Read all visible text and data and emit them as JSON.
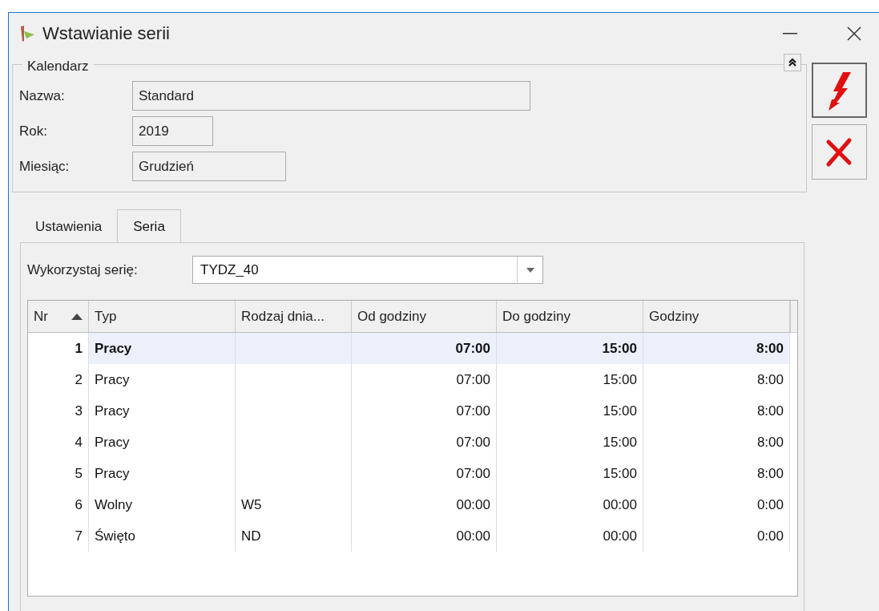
{
  "window": {
    "title": "Wstawianie serii"
  },
  "calendar": {
    "legend": "Kalendarz",
    "fields": [
      {
        "label": "Nazwa:",
        "value": "Standard"
      },
      {
        "label": "Rok:",
        "value": "2019"
      },
      {
        "label": "Miesiąc:",
        "value": "Grudzień"
      }
    ]
  },
  "tabs": [
    {
      "label": "Ustawienia",
      "selected": false
    },
    {
      "label": "Seria",
      "selected": true
    }
  ],
  "series": {
    "label": "Wykorzystaj serię:",
    "value": "TYDZ_40"
  },
  "table": {
    "columns": [
      {
        "label": "Nr",
        "sorted": true
      },
      {
        "label": "Typ",
        "sorted": false
      },
      {
        "label": "Rodzaj dnia...",
        "sorted": false
      },
      {
        "label": "Od godziny",
        "sorted": false
      },
      {
        "label": "Do godziny",
        "sorted": false
      },
      {
        "label": "Godziny",
        "sorted": false
      }
    ],
    "rows": [
      {
        "nr": "1",
        "typ": "Pracy",
        "rodzaj": "",
        "od": "07:00",
        "do": "15:00",
        "godziny": "8:00",
        "selected": true
      },
      {
        "nr": "2",
        "typ": "Pracy",
        "rodzaj": "",
        "od": "07:00",
        "do": "15:00",
        "godziny": "8:00",
        "selected": false
      },
      {
        "nr": "3",
        "typ": "Pracy",
        "rodzaj": "",
        "od": "07:00",
        "do": "15:00",
        "godziny": "8:00",
        "selected": false
      },
      {
        "nr": "4",
        "typ": "Pracy",
        "rodzaj": "",
        "od": "07:00",
        "do": "15:00",
        "godziny": "8:00",
        "selected": false
      },
      {
        "nr": "5",
        "typ": "Pracy",
        "rodzaj": "",
        "od": "07:00",
        "do": "15:00",
        "godziny": "8:00",
        "selected": false
      },
      {
        "nr": "6",
        "typ": "Wolny",
        "rodzaj": "W5",
        "od": "00:00",
        "do": "00:00",
        "godziny": "0:00",
        "selected": false
      },
      {
        "nr": "7",
        "typ": "Święto",
        "rodzaj": "ND",
        "od": "00:00",
        "do": "00:00",
        "godziny": "0:00",
        "selected": false
      }
    ]
  }
}
